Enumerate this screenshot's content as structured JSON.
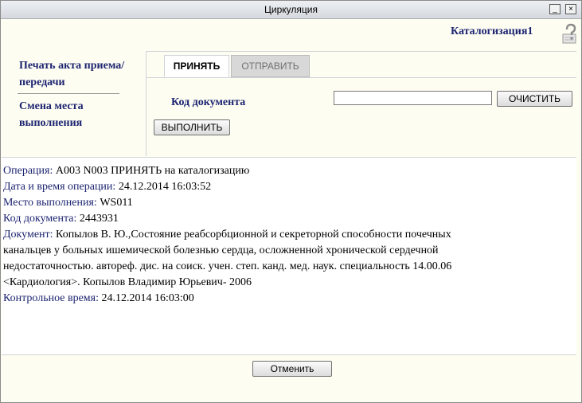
{
  "window": {
    "title": "Циркуляция",
    "minimize_glyph": "_",
    "close_glyph": "×"
  },
  "header": {
    "user": "Каталогизация1",
    "help_icon": "help-question-icon"
  },
  "sidebar": {
    "items": [
      {
        "lines": [
          "Печать акта приема/",
          "передачи"
        ]
      },
      {
        "lines": [
          "Смена места",
          "выполнения"
        ]
      }
    ]
  },
  "tabs": [
    {
      "label": "ПРИНЯТЬ",
      "active": true
    },
    {
      "label": "ОТПРАВИТЬ",
      "active": false
    }
  ],
  "form": {
    "doc_code_label": "Код документа",
    "doc_code_value": "",
    "clear_button": "ОЧИСТИТЬ",
    "execute_button": "ВЫПОЛНИТЬ"
  },
  "output": {
    "operation_label": "Операция:",
    "operation_value": " А003 N003 ПРИНЯТЬ на каталогизацию",
    "datetime_label": "Дата и время операции:",
    "datetime_value": " 24.12.2014 16:03:52",
    "place_label": "Место выполнения:",
    "place_value": " WS011",
    "code_label": "Код документа:",
    "code_value": " 2443931",
    "document_label": "Документ:",
    "document_lines": [
      " Копылов В. Ю.,Состояние реабсорбционной и секреторной способности почечных",
      "канальцев у больных ишемической болезнью сердца, осложненной хронической сердечной",
      "недостаточностью. автореф. дис. на соиск. учен. степ. канд. мед. наук. специальность 14.00.06",
      "<Кардиология>. Копылов Владимир Юрьевич- 2006"
    ],
    "control_label": "Контрольное время:",
    "control_value": " 24.12.2014 16:03:00"
  },
  "footer": {
    "cancel_button": "Отменить"
  },
  "colors": {
    "label_blue": "#1c2470",
    "background": "#fdfdf2"
  }
}
